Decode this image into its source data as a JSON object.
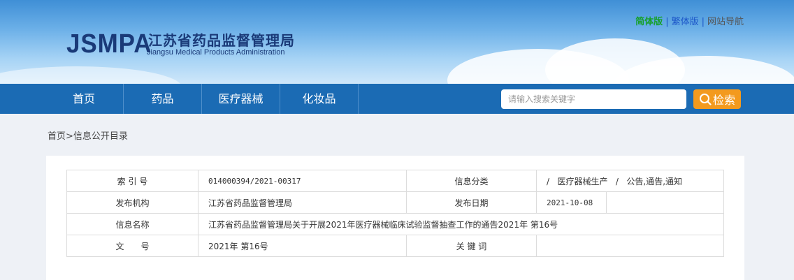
{
  "header": {
    "logo_abbr": "JSMPA",
    "logo_cn": "江苏省药品监督管理局",
    "logo_en": "Jiangsu Medical Products Administration",
    "links": {
      "simplified": "简体版",
      "traditional": "繁体版",
      "sitemap": "网站导航",
      "separator": "|"
    }
  },
  "nav": {
    "items": [
      "首页",
      "药品",
      "医疗器械",
      "化妆品"
    ],
    "search_placeholder": "请输入搜索关键字",
    "search_label": "检索"
  },
  "breadcrumb": "首页>信息公开目录",
  "info": {
    "index_label": "索 引 号",
    "index_value": "014000394/2021-00317",
    "category_label": "信息分类",
    "category_value": "/   医疗器械生产   /   公告,通告,通知",
    "publisher_label": "发布机构",
    "publisher_value": "江苏省药品监督管理局",
    "date_label": "发布日期",
    "date_value": "2021-10-08",
    "name_label": "信息名称",
    "name_value": "江苏省药品监督管理局关于开展2021年医疗器械临床试验监督抽查工作的通告2021年 第16号",
    "doc_label": "文　　号",
    "doc_value": "2021年 第16号",
    "keywords_label": "关 键 词",
    "keywords_value": ""
  }
}
